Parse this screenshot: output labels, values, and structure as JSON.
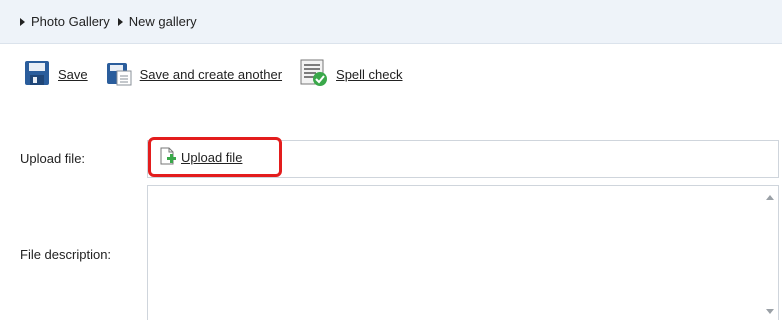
{
  "breadcrumb": {
    "items": [
      "Photo Gallery",
      "New gallery"
    ]
  },
  "toolbar": {
    "save": "Save",
    "save_another": "Save and create another",
    "spell_check": "Spell check"
  },
  "form": {
    "upload_label": "Upload file:",
    "upload_button": "Upload file",
    "description_label": "File description:"
  },
  "colors": {
    "breadcrumb_bg": "#eef3f9",
    "highlight": "#e31d1d"
  }
}
